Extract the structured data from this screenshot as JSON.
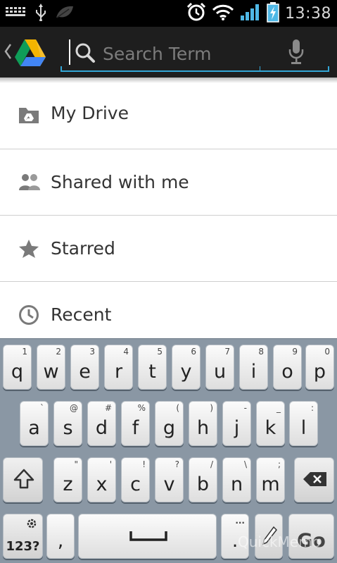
{
  "status_bar": {
    "time": "13:38",
    "icons": [
      "keyboard-grid-icon",
      "usb-icon",
      "leaf-icon",
      "alarm-icon",
      "wifi-icon",
      "signal-icon",
      "battery-charging-icon"
    ]
  },
  "action_bar": {
    "search_placeholder": "Search Term",
    "accent_color": "#33a6d6"
  },
  "nav": {
    "items": [
      {
        "label": "My Drive",
        "icon": "drive-folder-icon"
      },
      {
        "label": "Shared with me",
        "icon": "people-icon"
      },
      {
        "label": "Starred",
        "icon": "star-icon"
      },
      {
        "label": "Recent",
        "icon": "clock-icon"
      }
    ]
  },
  "keyboard": {
    "row1": [
      {
        "main": "q",
        "alt": "1"
      },
      {
        "main": "w",
        "alt": "2"
      },
      {
        "main": "e",
        "alt": "3"
      },
      {
        "main": "r",
        "alt": "4"
      },
      {
        "main": "t",
        "alt": "5"
      },
      {
        "main": "y",
        "alt": "6"
      },
      {
        "main": "u",
        "alt": "7"
      },
      {
        "main": "i",
        "alt": "8"
      },
      {
        "main": "o",
        "alt": "9"
      },
      {
        "main": "p",
        "alt": "0"
      }
    ],
    "row2": [
      {
        "main": "a",
        "alt": "`"
      },
      {
        "main": "s",
        "alt": "@"
      },
      {
        "main": "d",
        "alt": "#"
      },
      {
        "main": "f",
        "alt": "%"
      },
      {
        "main": "g",
        "alt": "("
      },
      {
        "main": "h",
        "alt": ")"
      },
      {
        "main": "j",
        "alt": "-"
      },
      {
        "main": "k",
        "alt": "_"
      },
      {
        "main": "l",
        "alt": ":"
      }
    ],
    "row3": [
      {
        "main": "z",
        "alt": "\""
      },
      {
        "main": "x",
        "alt": "'"
      },
      {
        "main": "c",
        "alt": "!"
      },
      {
        "main": "v",
        "alt": "?"
      },
      {
        "main": "b",
        "alt": "/"
      },
      {
        "main": "n",
        "alt": "\\"
      },
      {
        "main": "m",
        "alt": ";"
      }
    ],
    "symbols_label": "123?",
    "comma": ",",
    "go_label": "Go",
    "more_label": "...",
    "period": "."
  },
  "watermark": "QuickMemo"
}
